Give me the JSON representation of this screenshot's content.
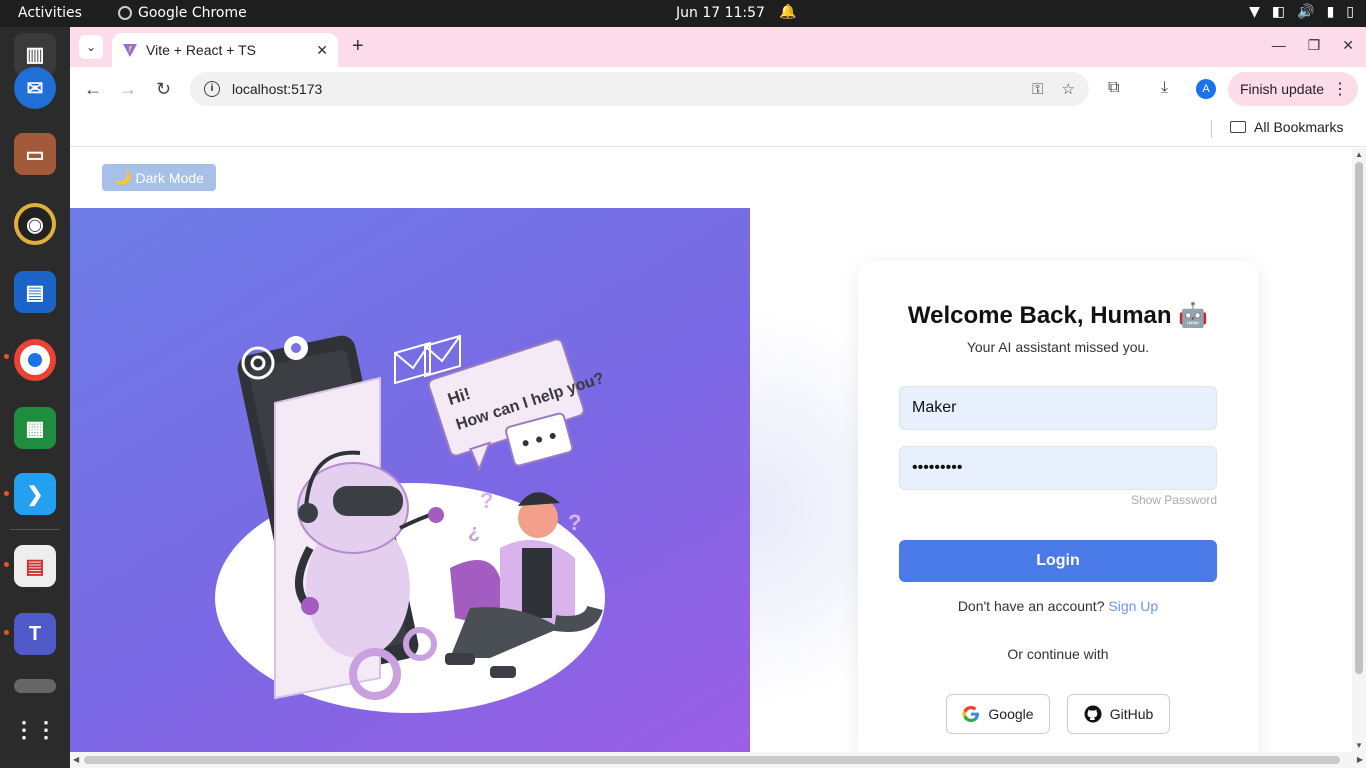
{
  "system": {
    "activities": "Activities",
    "app_name": "Google Chrome",
    "clock": "Jun 17  11:57"
  },
  "browser": {
    "tab_title": "Vite + React + TS",
    "url": "localhost:5173",
    "finish_update": "Finish update",
    "profile_initial": "A",
    "bookmarks_label": "All Bookmarks"
  },
  "page": {
    "dark_mode_label": "Dark Mode",
    "dark_mode_icon": "🌙",
    "heading": "Welcome Back, Human 🤖",
    "subheading": "Your AI assistant missed you.",
    "username_value": "Maker",
    "password_value": "•••••••••",
    "show_password": "Show Password",
    "login_label": "Login",
    "no_account_text": "Don't have an account?",
    "signup_link": "Sign Up",
    "or_continue": "Or continue with",
    "google_label": "Google",
    "github_label": "GitHub"
  },
  "colors": {
    "accent": "#4a7ae8",
    "panel_gradient_start": "#6d7ce6",
    "panel_gradient_end": "#9b5fe6",
    "tabstrip": "#fcdce8"
  }
}
